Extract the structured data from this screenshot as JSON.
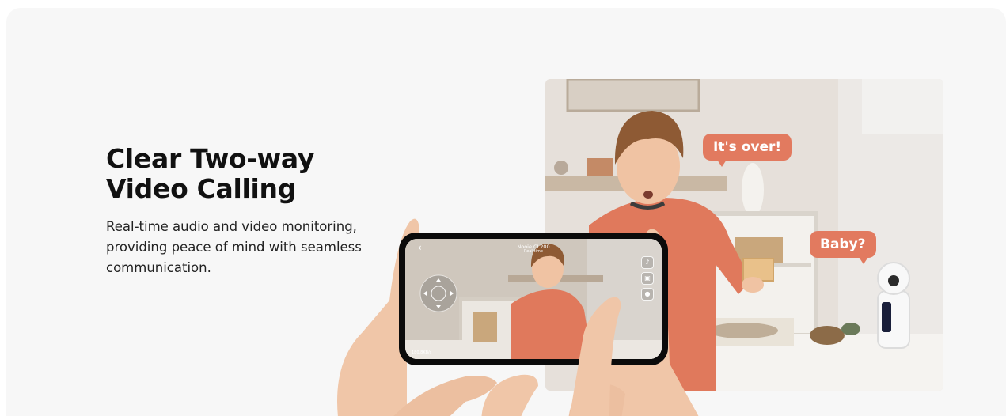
{
  "feature": {
    "title_line1": "Clear Two-way",
    "title_line2": "Video Calling",
    "description": "Real-time audio and video monitoring, providing peace of mind with seamless communication."
  },
  "scene": {
    "bubble_child": "It's over!",
    "bubble_parent": "Baby?"
  },
  "phone_app": {
    "device_name": "Nooie CL200",
    "status": "Real-time",
    "speed": "180.8KB/s",
    "icons": [
      "back-icon",
      "speaker-icon",
      "screenshot-icon",
      "record-icon",
      "ptz-joystick-icon"
    ]
  },
  "colors": {
    "bubble": "#e27a5f",
    "card_background": "#f7f7f7",
    "title": "#111111"
  }
}
